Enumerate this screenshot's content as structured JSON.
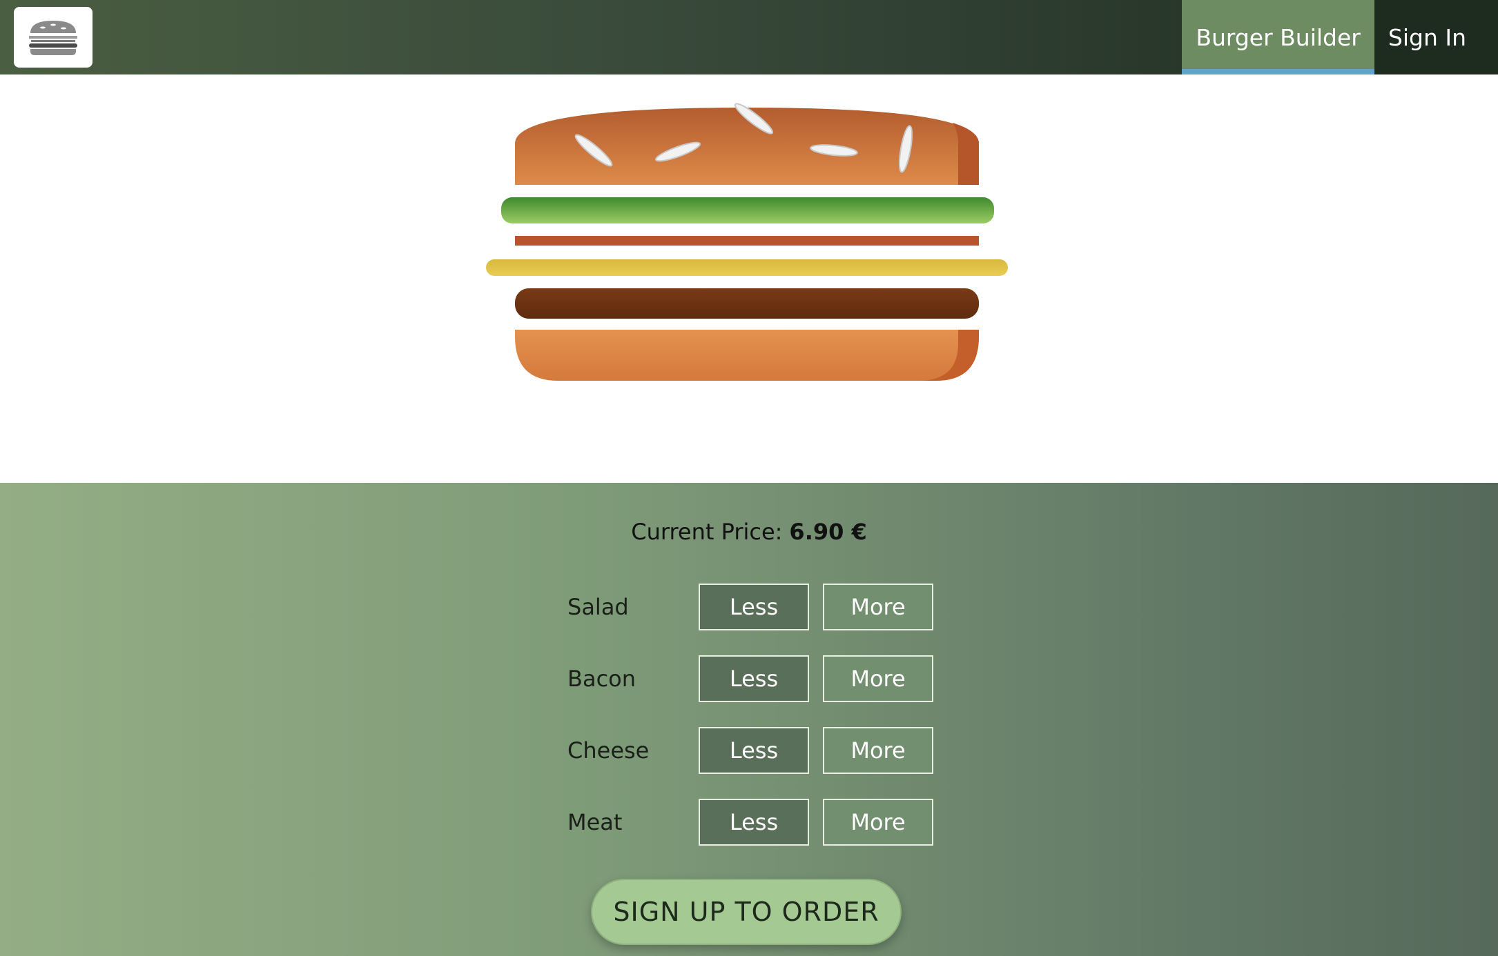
{
  "toolbar": {
    "logo_icon": "burger-logo-icon",
    "nav": [
      {
        "label": "Burger Builder",
        "active": true
      },
      {
        "label": "Sign In",
        "active": false
      }
    ]
  },
  "price": {
    "label": "Current Price:",
    "value": "6.90 €"
  },
  "controls": [
    {
      "label": "Salad",
      "less": "Less",
      "more": "More"
    },
    {
      "label": "Bacon",
      "less": "Less",
      "more": "More"
    },
    {
      "label": "Cheese",
      "less": "Less",
      "more": "More"
    },
    {
      "label": "Meat",
      "less": "Less",
      "more": "More"
    }
  ],
  "order_button": "SIGN UP TO ORDER",
  "colors": {
    "bread": "#d47a3c",
    "salad": "#6bb04a",
    "bacon": "#b8532d",
    "cheese": "#e6c84b",
    "meat": "#6e3412",
    "accent": "#5fa4c9"
  }
}
